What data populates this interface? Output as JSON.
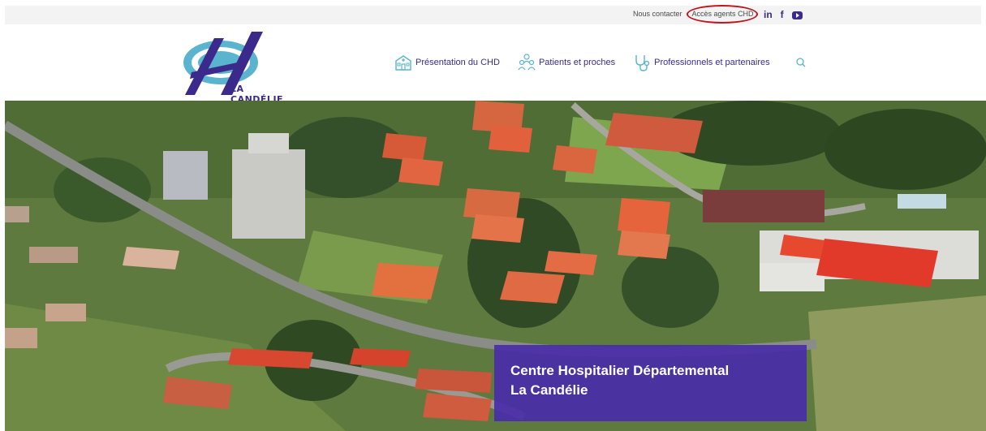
{
  "topbar": {
    "contact": "Nous contacter",
    "agents": "Accès agents CHD",
    "socials": {
      "linkedin": "in",
      "facebook": "f"
    }
  },
  "logo": {
    "text": "LA CANDÉLIE"
  },
  "nav": [
    {
      "label": "Présentation du CHD",
      "icon": "hospital-building-icon"
    },
    {
      "label": "Patients et proches",
      "icon": "people-icon"
    },
    {
      "label": "Professionnels et partenaires",
      "icon": "stethoscope-icon"
    }
  ],
  "hero": {
    "line1": "Centre Hospitalier Départemental",
    "line2": "La Candélie"
  },
  "colors": {
    "brand": "#3b2a8c",
    "accent_teal": "#5ab4cf",
    "banner": "#492da8",
    "highlight_circle": "#c0141c"
  }
}
